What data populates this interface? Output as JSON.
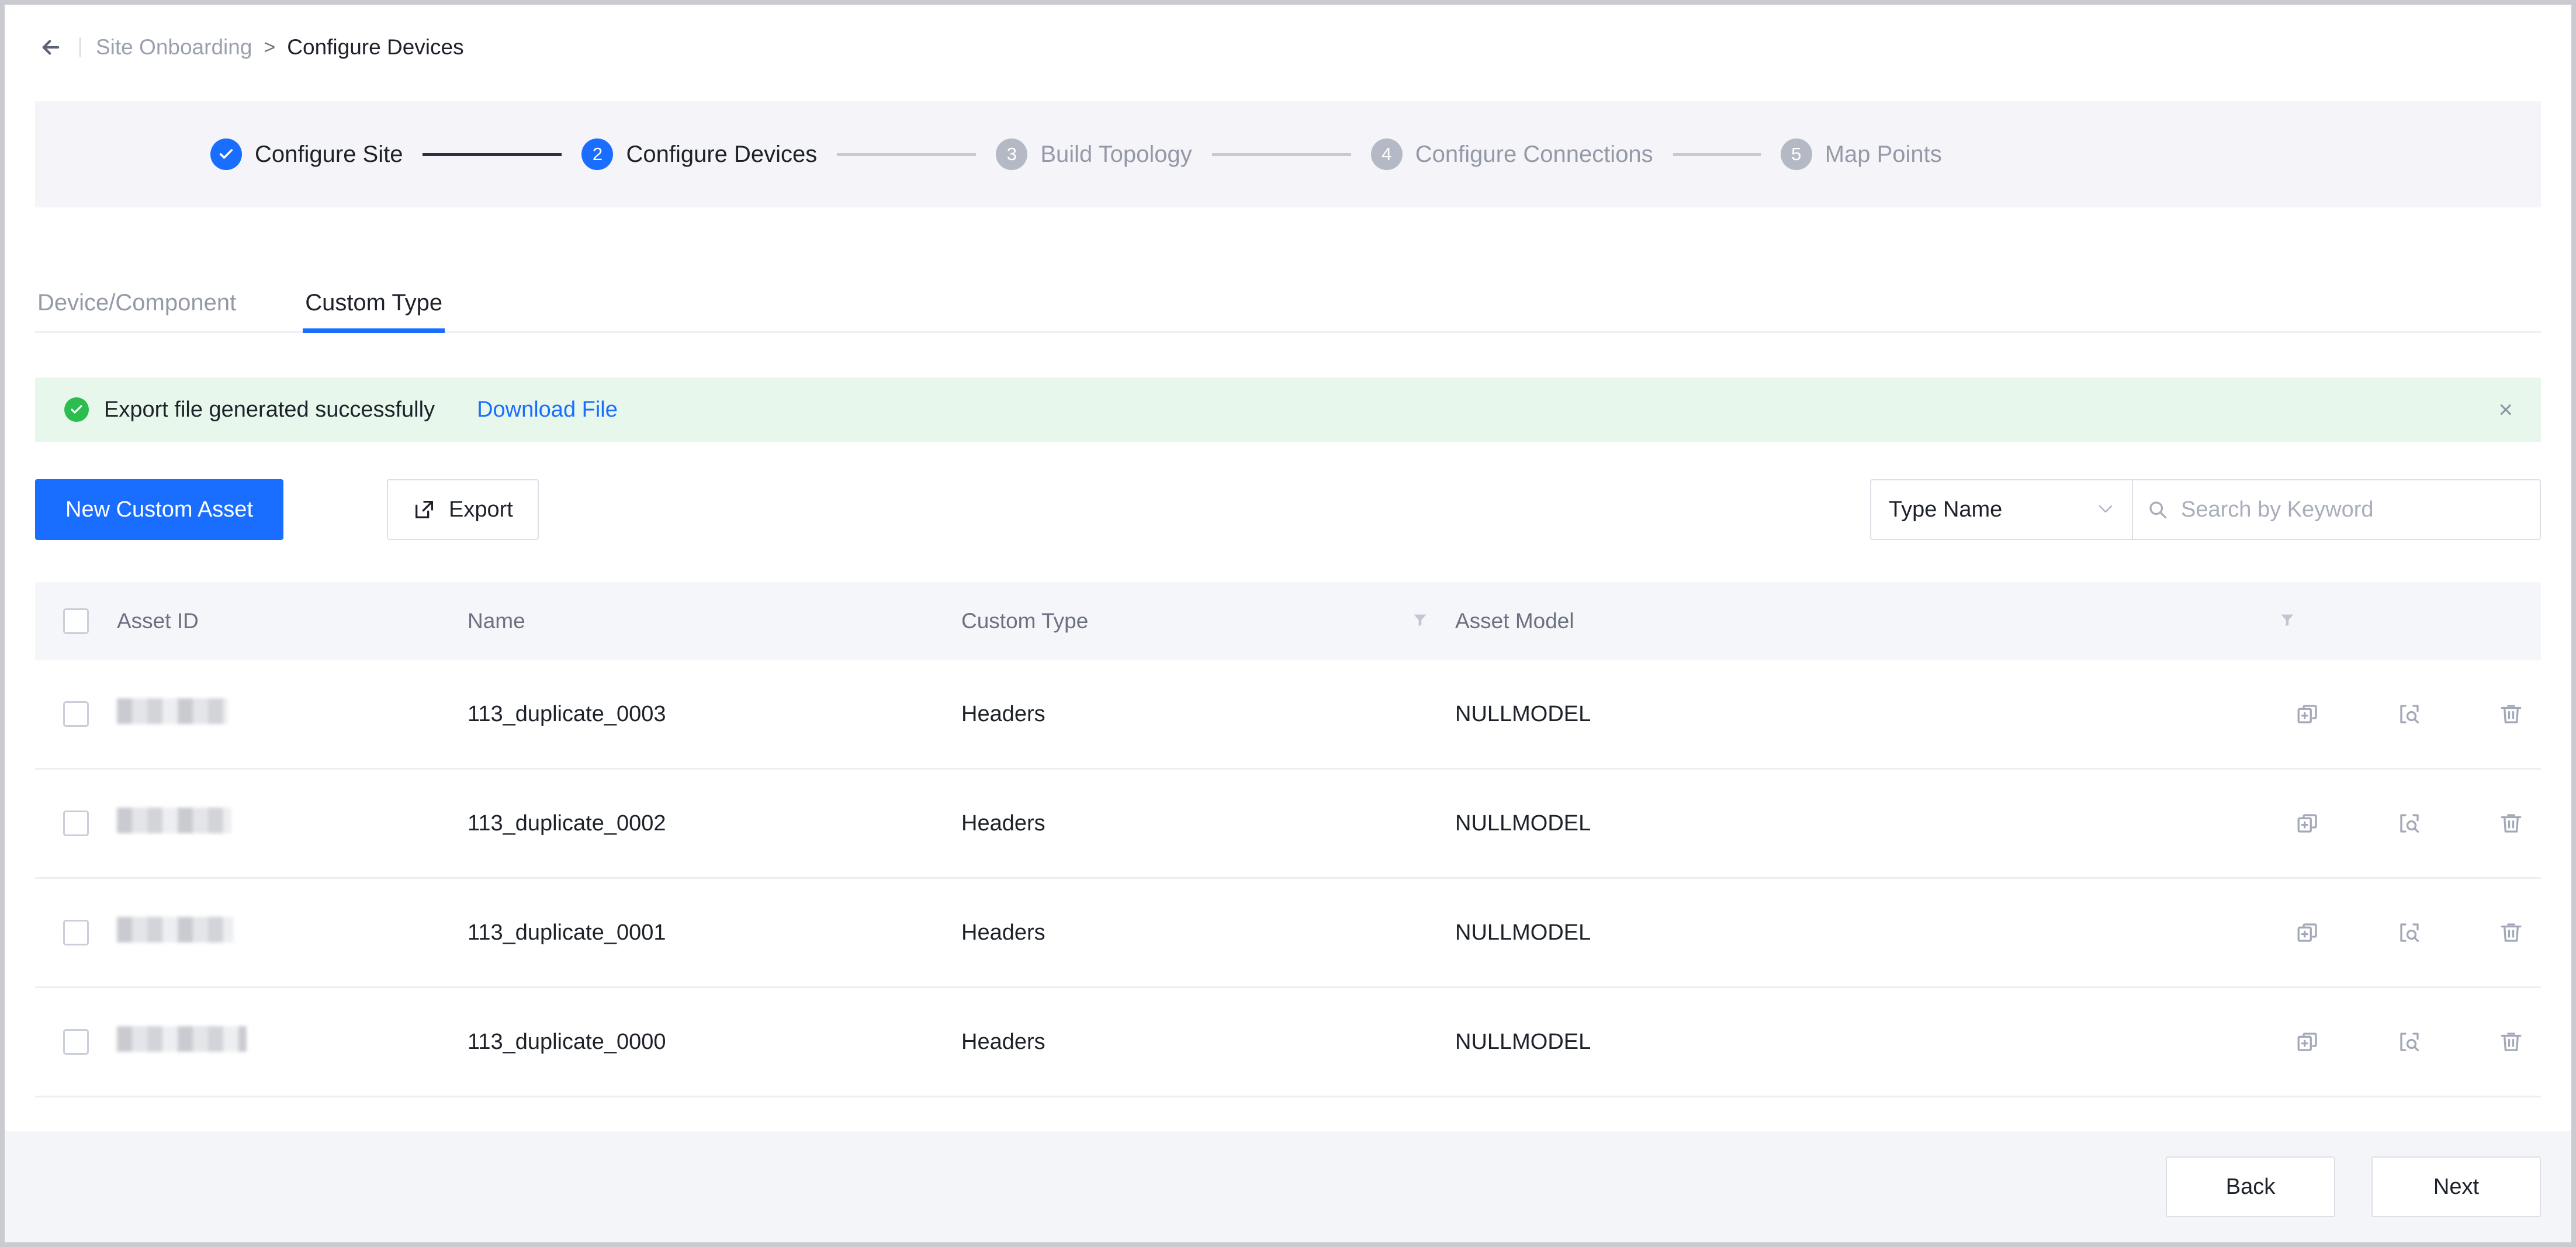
{
  "breadcrumb": {
    "back_icon": "arrow-left-icon",
    "parent": "Site Onboarding",
    "separator": ">",
    "current": "Configure Devices"
  },
  "stepper": {
    "steps": [
      {
        "num": "1",
        "badge": "✓",
        "label": "Configure Site",
        "state": "done"
      },
      {
        "num": "2",
        "badge": "2",
        "label": "Configure Devices",
        "state": "active"
      },
      {
        "num": "3",
        "badge": "3",
        "label": "Build Topology",
        "state": "todo"
      },
      {
        "num": "4",
        "badge": "4",
        "label": "Configure Connections",
        "state": "todo"
      },
      {
        "num": "5",
        "badge": "5",
        "label": "Map Points",
        "state": "todo"
      }
    ]
  },
  "tabs": [
    {
      "label": "Device/Component",
      "active": false
    },
    {
      "label": "Custom Type",
      "active": true
    }
  ],
  "alert": {
    "icon": "check-circle-icon",
    "message": "Export file generated successfully",
    "link": "Download File",
    "close": "×"
  },
  "toolbar": {
    "new_asset_label": "New Custom Asset",
    "export_label": "Export",
    "export_icon": "external-link-icon",
    "type_select_value": "Type Name",
    "type_select_caret": "∨",
    "search_icon": "search-icon",
    "search_placeholder": "Search by Keyword",
    "search_value": ""
  },
  "table": {
    "columns": [
      {
        "key": "asset_id",
        "label": "Asset ID",
        "filter": false
      },
      {
        "key": "name",
        "label": "Name",
        "filter": false
      },
      {
        "key": "custom_type",
        "label": "Custom Type",
        "filter": true
      },
      {
        "key": "asset_model",
        "label": "Asset Model",
        "filter": true
      }
    ],
    "row_actions": [
      {
        "name": "duplicate-icon"
      },
      {
        "name": "preview-icon"
      },
      {
        "name": "delete-icon"
      }
    ],
    "rows": [
      {
        "asset_id": "",
        "name": "113_duplicate_0003",
        "custom_type": "Headers",
        "asset_model": "NULLMODEL"
      },
      {
        "asset_id": "",
        "name": "113_duplicate_0002",
        "custom_type": "Headers",
        "asset_model": "NULLMODEL"
      },
      {
        "asset_id": "",
        "name": "113_duplicate_0001",
        "custom_type": "Headers",
        "asset_model": "NULLMODEL"
      },
      {
        "asset_id": "",
        "name": "113_duplicate_0000",
        "custom_type": "Headers",
        "asset_model": "NULLMODEL"
      }
    ]
  },
  "footer": {
    "back_label": "Back",
    "next_label": "Next"
  },
  "colors": {
    "accent": "#1a6eff",
    "success": "#2bbd4e",
    "success_bg": "#e7f7ec",
    "panel_bg": "#f5f5f9",
    "text": "#1d2129",
    "muted": "#9499a8"
  }
}
